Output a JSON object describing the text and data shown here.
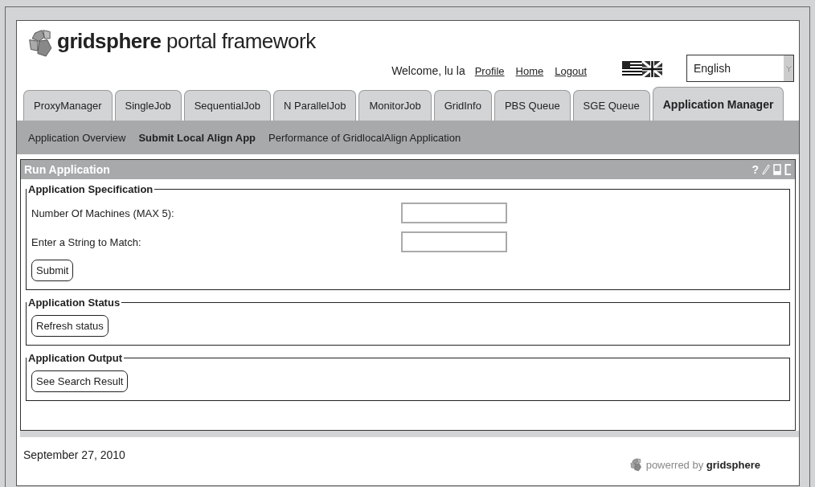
{
  "header": {
    "logo_text": "**gridsphere** portal framework",
    "welcome": "Welcome, lu la",
    "links": [
      "Profile",
      "Home",
      "Logout"
    ],
    "language": {
      "value": "English"
    }
  },
  "tabs": [
    {
      "label": "ProxyManager",
      "selected": false
    },
    {
      "label": "SingleJob",
      "selected": false
    },
    {
      "label": "SequentialJob",
      "selected": false
    },
    {
      "label": "N ParallelJob",
      "selected": false
    },
    {
      "label": "MonitorJob",
      "selected": false
    },
    {
      "label": "GridInfo",
      "selected": false
    },
    {
      "label": "PBS Queue",
      "selected": false
    },
    {
      "label": "SGE Queue",
      "selected": false
    },
    {
      "label": "Application Manager",
      "selected": true
    }
  ],
  "subnav": [
    {
      "label": "Application Overview",
      "selected": false
    },
    {
      "label": "Submit Local Align App",
      "selected": true
    },
    {
      "label": "Performance of GridlocalAlign Application",
      "selected": false
    }
  ],
  "portlet": {
    "title": "Run Application",
    "help": "?",
    "sections": [
      {
        "legend": "Application Specification",
        "fields": [
          {
            "label": "Number Of Machines (MAX 5):"
          },
          {
            "label": "Enter a String to Match:"
          }
        ],
        "button": "Submit"
      },
      {
        "legend": "Application Status",
        "button": "Refresh status"
      },
      {
        "legend": "Application Output",
        "button": "See Search Result"
      }
    ]
  },
  "footer": {
    "date": "September 27, 2010",
    "powered": "powerred by **gridsphere**"
  }
}
